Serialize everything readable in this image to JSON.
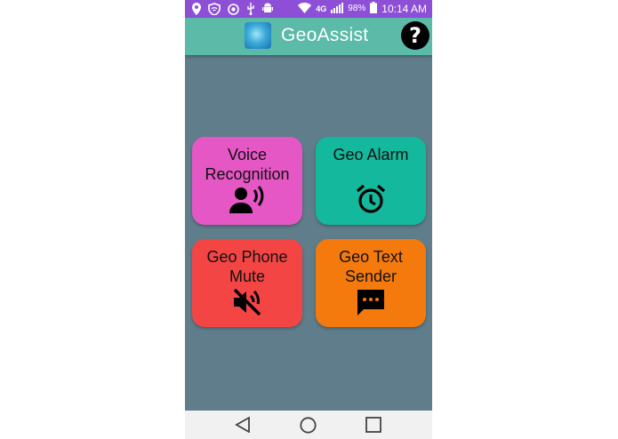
{
  "status_bar": {
    "network": "4G",
    "battery": "98%",
    "time": "10:14 AM"
  },
  "app_bar": {
    "title": "GeoAssist",
    "help_label": "?"
  },
  "tiles": [
    {
      "label": "Voice\nRecognition",
      "icon": "voice-person-icon",
      "color": "#e557c4"
    },
    {
      "label": "Geo Alarm",
      "icon": "alarm-clock-icon",
      "color": "#14b89c"
    },
    {
      "label": "Geo Phone\nMute",
      "icon": "volume-off-icon",
      "color": "#f44545"
    },
    {
      "label": "Geo Text\nSender",
      "icon": "message-icon",
      "color": "#f47a0e"
    }
  ],
  "colors": {
    "status_bar": "#8d4fd6",
    "app_bar": "#5bbaa8",
    "background": "#607d8b"
  },
  "nav_bar": {
    "back": "back-icon",
    "home": "home-icon",
    "recents": "recents-icon"
  }
}
